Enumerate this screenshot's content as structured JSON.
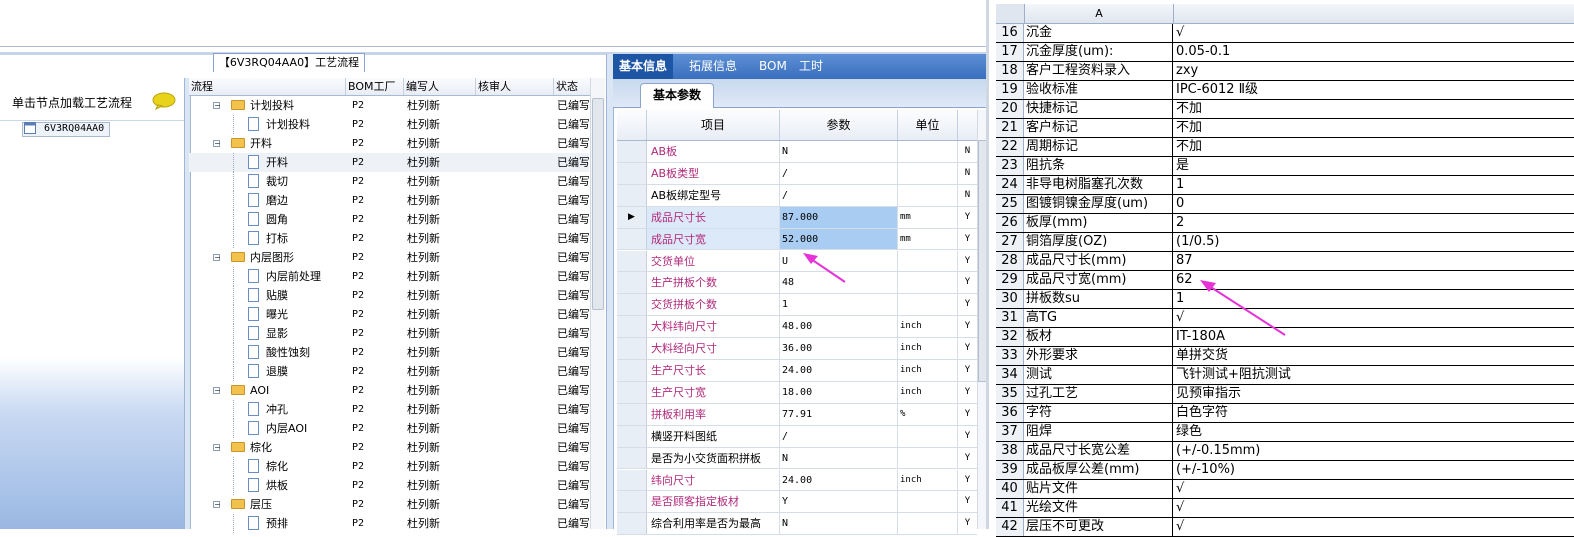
{
  "tab_title": "【6V3RQ04AA0】工艺流程",
  "left_nav": {
    "header": "单击节点加载工艺流程",
    "tree_root": "6V3RQ04AA0",
    "chat_icon": "speech-bubble-icon"
  },
  "process_grid": {
    "columns": [
      "流程",
      "BOM工厂",
      "编写人",
      "核审人",
      "状态"
    ],
    "rows": [
      {
        "level": 0,
        "type": "folder",
        "name": "计划投料",
        "bom": "P2",
        "author": "杜列新",
        "reviewer": "",
        "status": "已编写"
      },
      {
        "level": 1,
        "type": "doc",
        "name": "计划投料",
        "bom": "P2",
        "author": "杜列新",
        "reviewer": "",
        "status": "已编写"
      },
      {
        "level": 0,
        "type": "folder",
        "name": "开料",
        "bom": "P2",
        "author": "杜列新",
        "reviewer": "",
        "status": "已编写"
      },
      {
        "level": 1,
        "type": "doc",
        "name": "开料",
        "bom": "P2",
        "author": "杜列新",
        "reviewer": "",
        "status": "已编写",
        "selected": true
      },
      {
        "level": 1,
        "type": "doc",
        "name": "裁切",
        "bom": "P2",
        "author": "杜列新",
        "reviewer": "",
        "status": "已编写"
      },
      {
        "level": 1,
        "type": "doc",
        "name": "磨边",
        "bom": "P2",
        "author": "杜列新",
        "reviewer": "",
        "status": "已编写"
      },
      {
        "level": 1,
        "type": "doc",
        "name": "圆角",
        "bom": "P2",
        "author": "杜列新",
        "reviewer": "",
        "status": "已编写"
      },
      {
        "level": 1,
        "type": "doc",
        "name": "打标",
        "bom": "P2",
        "author": "杜列新",
        "reviewer": "",
        "status": "已编写"
      },
      {
        "level": 0,
        "type": "folder",
        "name": "内层图形",
        "bom": "P2",
        "author": "杜列新",
        "reviewer": "",
        "status": "已编写"
      },
      {
        "level": 1,
        "type": "doc",
        "name": "内层前处理",
        "bom": "P2",
        "author": "杜列新",
        "reviewer": "",
        "status": "已编写"
      },
      {
        "level": 1,
        "type": "doc",
        "name": "贴膜",
        "bom": "P2",
        "author": "杜列新",
        "reviewer": "",
        "status": "已编写"
      },
      {
        "level": 1,
        "type": "doc",
        "name": "曝光",
        "bom": "P2",
        "author": "杜列新",
        "reviewer": "",
        "status": "已编写"
      },
      {
        "level": 1,
        "type": "doc",
        "name": "显影",
        "bom": "P2",
        "author": "杜列新",
        "reviewer": "",
        "status": "已编写"
      },
      {
        "level": 1,
        "type": "doc",
        "name": "酸性蚀刻",
        "bom": "P2",
        "author": "杜列新",
        "reviewer": "",
        "status": "已编写"
      },
      {
        "level": 1,
        "type": "doc",
        "name": "退膜",
        "bom": "P2",
        "author": "杜列新",
        "reviewer": "",
        "status": "已编写"
      },
      {
        "level": 0,
        "type": "folder",
        "name": "AOI",
        "bom": "P2",
        "author": "杜列新",
        "reviewer": "",
        "status": "已编写"
      },
      {
        "level": 1,
        "type": "doc",
        "name": "冲孔",
        "bom": "P2",
        "author": "杜列新",
        "reviewer": "",
        "status": "已编写"
      },
      {
        "level": 1,
        "type": "doc",
        "name": "内层AOI",
        "bom": "P2",
        "author": "杜列新",
        "reviewer": "",
        "status": "已编写"
      },
      {
        "level": 0,
        "type": "folder",
        "name": "棕化",
        "bom": "P2",
        "author": "杜列新",
        "reviewer": "",
        "status": "已编写"
      },
      {
        "level": 1,
        "type": "doc",
        "name": "棕化",
        "bom": "P2",
        "author": "杜列新",
        "reviewer": "",
        "status": "已编写"
      },
      {
        "level": 1,
        "type": "doc",
        "name": "烘板",
        "bom": "P2",
        "author": "杜列新",
        "reviewer": "",
        "status": "已编写"
      },
      {
        "level": 0,
        "type": "folder",
        "name": "层压",
        "bom": "P2",
        "author": "杜列新",
        "reviewer": "",
        "status": "已编写"
      },
      {
        "level": 1,
        "type": "doc",
        "name": "预排",
        "bom": "P2",
        "author": "杜列新",
        "reviewer": "",
        "status": "已编写"
      }
    ]
  },
  "info_panel": {
    "tabs": [
      "基本信息",
      "拓展信息",
      "BOM",
      "工时"
    ],
    "sub_tab": "基本参数",
    "columns": [
      "项目",
      "参数",
      "单位"
    ],
    "rows": [
      {
        "name": "AB板",
        "value": "N",
        "unit": "",
        "flag": "N",
        "pink": true
      },
      {
        "name": "AB板类型",
        "value": "/",
        "unit": "",
        "flag": "N",
        "pink": true
      },
      {
        "name": "AB板绑定型号",
        "value": "/",
        "unit": "",
        "flag": "N",
        "pink": false
      },
      {
        "name": "成品尺寸长",
        "value": "87.000",
        "unit": "mm",
        "flag": "Y",
        "pink": true,
        "current": true
      },
      {
        "name": "成品尺寸宽",
        "value": "52.000",
        "unit": "mm",
        "flag": "Y",
        "pink": true
      },
      {
        "name": "交货单位",
        "value": "U",
        "unit": "",
        "flag": "Y",
        "pink": true
      },
      {
        "name": "生产拼板个数",
        "value": "48",
        "unit": "",
        "flag": "Y",
        "pink": true
      },
      {
        "name": "交货拼板个数",
        "value": "1",
        "unit": "",
        "flag": "Y",
        "pink": true
      },
      {
        "name": "大料纬向尺寸",
        "value": "48.00",
        "unit": "inch",
        "flag": "Y",
        "pink": true
      },
      {
        "name": "大料经向尺寸",
        "value": "36.00",
        "unit": "inch",
        "flag": "Y",
        "pink": true
      },
      {
        "name": "生产尺寸长",
        "value": "24.00",
        "unit": "inch",
        "flag": "Y",
        "pink": true
      },
      {
        "name": "生产尺寸宽",
        "value": "18.00",
        "unit": "inch",
        "flag": "Y",
        "pink": true
      },
      {
        "name": "拼板利用率",
        "value": "77.91",
        "unit": "%",
        "flag": "Y",
        "pink": true
      },
      {
        "name": "横竖开料图纸",
        "value": "/",
        "unit": "",
        "flag": "Y",
        "pink": false
      },
      {
        "name": "是否为小交货面积拼板",
        "value": "N",
        "unit": "",
        "flag": "Y",
        "pink": false
      },
      {
        "name": "纬向尺寸",
        "value": "24.00",
        "unit": "inch",
        "flag": "Y",
        "pink": true
      },
      {
        "name": "是否顾客指定板材",
        "value": "Y",
        "unit": "",
        "flag": "Y",
        "pink": true
      },
      {
        "name": "综合利用率是否为最高",
        "value": "N",
        "unit": "",
        "flag": "Y",
        "pink": false
      }
    ]
  },
  "spreadsheet": {
    "column_a": "A",
    "rows": [
      {
        "n": "16",
        "a": "沉金",
        "b": "√"
      },
      {
        "n": "17",
        "a": "沉金厚度(um):",
        "b": "0.05-0.1"
      },
      {
        "n": "18",
        "a": "客户工程资料录入",
        "b": "zxy"
      },
      {
        "n": "19",
        "a": "验收标准",
        "b": "IPC-6012 Ⅱ级"
      },
      {
        "n": "20",
        "a": "快捷标记",
        "b": "不加"
      },
      {
        "n": "21",
        "a": "客户标记",
        "b": "不加"
      },
      {
        "n": "22",
        "a": "周期标记",
        "b": "不加"
      },
      {
        "n": "23",
        "a": "阻抗条",
        "b": "是"
      },
      {
        "n": "24",
        "a": "非导电树脂塞孔次数",
        "b": "1"
      },
      {
        "n": "25",
        "a": "图镀铜镍金厚度(um)",
        "b": "0"
      },
      {
        "n": "26",
        "a": "板厚(mm)",
        "b": "2"
      },
      {
        "n": "27",
        "a": "铜箔厚度(OZ)",
        "b": "(1/0.5)"
      },
      {
        "n": "28",
        "a": "成品尺寸长(mm)",
        "b": "87"
      },
      {
        "n": "29",
        "a": "成品尺寸宽(mm)",
        "b": "62"
      },
      {
        "n": "30",
        "a": "拼板数su",
        "b": "1"
      },
      {
        "n": "31",
        "a": "高TG",
        "b": "√"
      },
      {
        "n": "32",
        "a": "板材",
        "b": "IT-180A"
      },
      {
        "n": "33",
        "a": "外形要求",
        "b": "单拼交货"
      },
      {
        "n": "34",
        "a": "测试",
        "b": "飞针测试+阻抗测试"
      },
      {
        "n": "35",
        "a": "过孔工艺",
        "b": "见预审指示"
      },
      {
        "n": "36",
        "a": "字符",
        "b": "白色字符"
      },
      {
        "n": "37",
        "a": "阻焊",
        "b": "绿色"
      },
      {
        "n": "38",
        "a": "成品尺寸长宽公差",
        "b": "(+/-0.15mm)"
      },
      {
        "n": "39",
        "a": "成品板厚公差(mm)",
        "b": "(+/-10%)"
      },
      {
        "n": "40",
        "a": "贴片文件",
        "b": "√"
      },
      {
        "n": "41",
        "a": "光绘文件",
        "b": "√"
      },
      {
        "n": "42",
        "a": "层压不可更改",
        "b": "√"
      }
    ]
  },
  "annotation_color": "#e632d6"
}
